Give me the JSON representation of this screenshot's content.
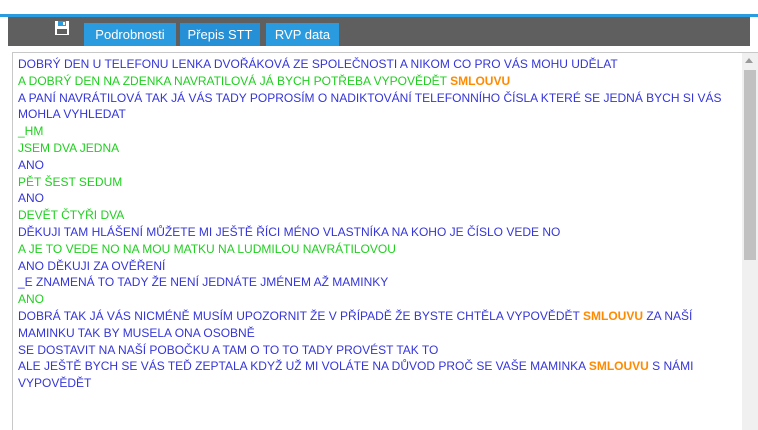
{
  "toolbar": {
    "save_icon": "floppy-disk-icon",
    "tabs": [
      {
        "label": "Podrobnosti",
        "active": false
      },
      {
        "label": "Přepis STT",
        "active": true
      },
      {
        "label": "RVP data",
        "active": false
      }
    ]
  },
  "colors": {
    "accent": "#2b9be0",
    "toolbar": "#5f5f5f",
    "speaker_a": "#3535d8",
    "speaker_b": "#1fcf1f",
    "keyword": "#ff8a00"
  },
  "transcript": {
    "lines": [
      {
        "speaker": "blue",
        "parts": [
          {
            "text": "DOBRÝ DEN U TELEFONU LENKA DVOŘÁKOVÁ ZE SPOLEČNOSTI A NIKOM CO PRO VÁS MOHU UDĚLAT"
          }
        ]
      },
      {
        "speaker": "green",
        "parts": [
          {
            "text": "A DOBRÝ DEN NA ZDENKA NAVRATILOVÁ JÁ BYCH POTŘEBA VYPOVĚDĚT "
          },
          {
            "text": "SMLOUVU",
            "kw": true
          }
        ]
      },
      {
        "speaker": "blue",
        "parts": [
          {
            "text": "A PANÍ NAVRÁTILOVÁ TAK JÁ VÁS TADY POPROSÍM O NADIKTOVÁNÍ TELEFONNÍHO ČÍSLA KTERÉ SE JEDNÁ BYCH SI VÁS MOHLA VYHLEDAT"
          }
        ]
      },
      {
        "speaker": "green",
        "parts": [
          {
            "text": "_HM"
          }
        ]
      },
      {
        "speaker": "green",
        "parts": [
          {
            "text": "JSEM DVA JEDNA"
          }
        ]
      },
      {
        "speaker": "blue",
        "parts": [
          {
            "text": "ANO"
          }
        ]
      },
      {
        "speaker": "green",
        "parts": [
          {
            "text": "PĚT ŠEST SEDUM"
          }
        ]
      },
      {
        "speaker": "blue",
        "parts": [
          {
            "text": "ANO"
          }
        ]
      },
      {
        "speaker": "green",
        "parts": [
          {
            "text": "DEVĚT ČTYŘI DVA"
          }
        ]
      },
      {
        "speaker": "blue",
        "parts": [
          {
            "text": "DĚKUJI TAM HLÁŠENÍ MŮŽETE MI JEŠTĚ ŘÍCI MÉNO VLASTNÍKA NA KOHO JE ČÍSLO VEDE NO"
          }
        ]
      },
      {
        "speaker": "green",
        "parts": [
          {
            "text": "A JE TO VEDE NO NA MOU MATKU NA LUDMILOU NAVRÁTILOVOU"
          }
        ]
      },
      {
        "speaker": "blue",
        "parts": [
          {
            "text": "ANO DĚKUJI ZA OVĚŘENÍ"
          }
        ]
      },
      {
        "speaker": "blue",
        "parts": [
          {
            "text": "_E ZNAMENÁ TO TADY ŽE NENÍ JEDNÁTE JMÉNEM AŽ MAMINKY"
          }
        ]
      },
      {
        "speaker": "green",
        "parts": [
          {
            "text": "ANO"
          }
        ]
      },
      {
        "speaker": "blue",
        "parts": [
          {
            "text": "DOBRÁ TAK JÁ VÁS NICMÉNĚ MUSÍM UPOZORNIT ŽE V PŘÍPADĚ ŽE BYSTE CHTĚLA VYPOVĚDĚT "
          },
          {
            "text": "SMLOUVU",
            "kw": true
          },
          {
            "text": " ZA NAŠÍ MAMINKU TAK BY MUSELA ONA OSOBNĚ"
          }
        ]
      },
      {
        "speaker": "blue",
        "parts": [
          {
            "text": "SE DOSTAVIT NA NAŠÍ POBOČKU A TAM O TO TO TADY PROVÉST TAK TO"
          }
        ]
      },
      {
        "speaker": "blue",
        "parts": [
          {
            "text": "ALE JEŠTĚ BYCH SE VÁS TEĎ ZEPTALA KDYŽ UŽ MI VOLÁTE NA DŮVOD PROČ SE VAŠE MAMINKA "
          },
          {
            "text": "SMLOUVU",
            "kw": true
          },
          {
            "text": " S NÁMI VYPOVĚDĚT"
          }
        ]
      }
    ]
  }
}
